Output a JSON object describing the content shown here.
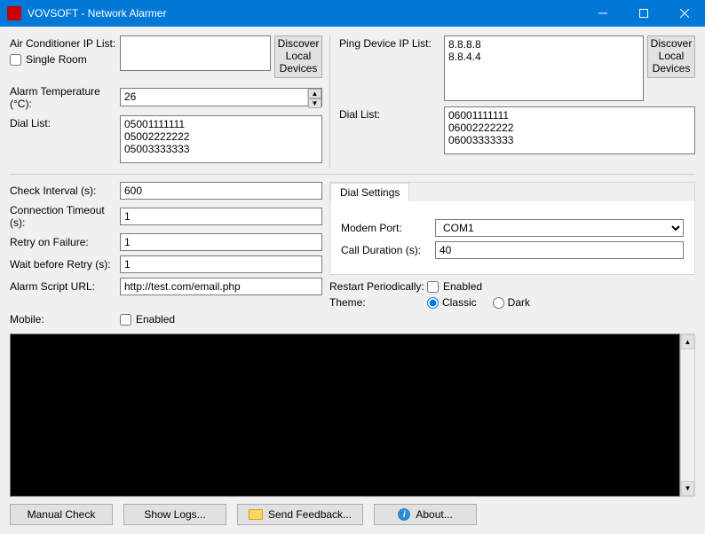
{
  "title": "VOVSOFT - Network Alarmer",
  "left": {
    "ac_ip_label": "Air Conditioner IP List:",
    "ac_ip_value": "",
    "single_room_label": "Single Room",
    "single_room_checked": false,
    "discover_btn": "Discover\nLocal\nDevices",
    "alarm_temp_label": "Alarm Temperature (°C):",
    "alarm_temp_value": "26",
    "dial_list_label": "Dial List:",
    "dial_list_value": "05001111111\n05002222222\n05003333333"
  },
  "right": {
    "ping_label": "Ping Device IP List:",
    "ping_value": "8.8.8.8\n8.8.4.4",
    "discover_btn": "Discover\nLocal\nDevices",
    "dial_list_label": "Dial List:",
    "dial_list_value": "06001111111\n06002222222\n06003333333"
  },
  "settings": {
    "check_interval_label": "Check Interval (s):",
    "check_interval_value": "600",
    "conn_timeout_label": "Connection Timeout (s):",
    "conn_timeout_value": "1",
    "retry_label": "Retry on Failure:",
    "retry_value": "1",
    "wait_label": "Wait before Retry (s):",
    "wait_value": "1",
    "script_label": "Alarm Script URL:",
    "script_value": "http://test.com/email.php",
    "mobile_label": "Mobile:",
    "mobile_enabled_label": "Enabled",
    "mobile_enabled": false
  },
  "dial": {
    "tab_label": "Dial Settings",
    "modem_label": "Modem Port:",
    "modem_value": "COM1",
    "duration_label": "Call Duration (s):",
    "duration_value": "40"
  },
  "options": {
    "restart_label": "Restart Periodically:",
    "restart_enabled_label": "Enabled",
    "restart_enabled": false,
    "theme_label": "Theme:",
    "theme_classic": "Classic",
    "theme_dark": "Dark",
    "theme_value": "Classic"
  },
  "buttons": {
    "manual_check": "Manual Check",
    "show_logs": "Show Logs...",
    "send_feedback": "Send Feedback...",
    "about": "About..."
  }
}
